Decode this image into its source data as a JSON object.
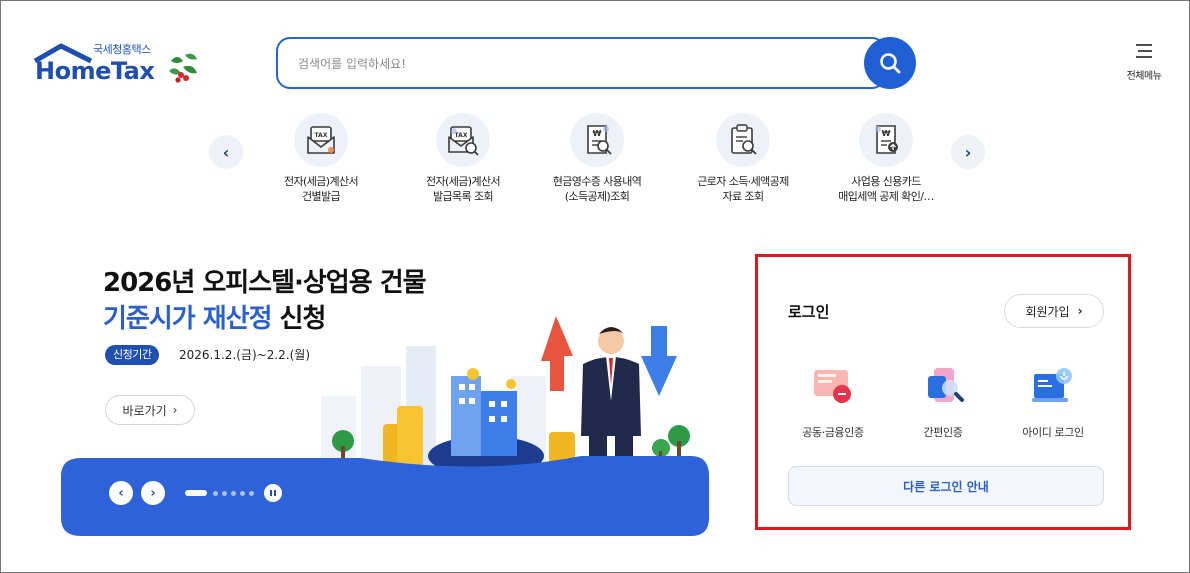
{
  "header": {
    "logo_small": "국세청홈택스",
    "logo_main": "HomeTax",
    "search_placeholder": "검색어를 입력하세요!",
    "menu_label": "전체메뉴"
  },
  "quick_menu": {
    "items": [
      {
        "line1": "전자(세금)계산서",
        "line2": "건별발급",
        "icon": "tax-invoice-envelope-icon"
      },
      {
        "line1": "전자(세금)계산서",
        "line2": "발급목록 조회",
        "icon": "tax-invoice-search-icon"
      },
      {
        "line1": "현금영수증 사용내역",
        "line2": "(소득공제)조회",
        "icon": "cash-receipt-search-icon"
      },
      {
        "line1": "근로자 소득·세액공제",
        "line2": "자료 조회",
        "icon": "clipboard-search-icon"
      },
      {
        "line1": "사업용 신용카드",
        "line2": "매입세액 공제 확인/…",
        "icon": "card-receipt-icon"
      }
    ]
  },
  "banner": {
    "title_line1": "2026년 오피스텔·상업용 건물",
    "title_line2_highlight": "기준시가 재산정",
    "title_line2_rest": " 신청",
    "period_badge": "신청기간",
    "period_text": "2026.1.2.(금)~2.2.(월)",
    "goto_label": "바로가기",
    "slide_count": 6,
    "active_slide": 1
  },
  "login": {
    "title": "로그인",
    "signup_label": "회원가입",
    "options": [
      {
        "label": "공동·금융인증",
        "icon": "certificate-icon"
      },
      {
        "label": "간편인증",
        "icon": "simple-auth-icon"
      },
      {
        "label": "아이디 로그인",
        "icon": "id-login-monitor-icon"
      }
    ],
    "other_login_label": "다른 로그인 안내"
  },
  "colors": {
    "brand_blue": "#1f5fd6",
    "highlight_red": "#e0181e",
    "banner_bar": "#2e62d8"
  }
}
